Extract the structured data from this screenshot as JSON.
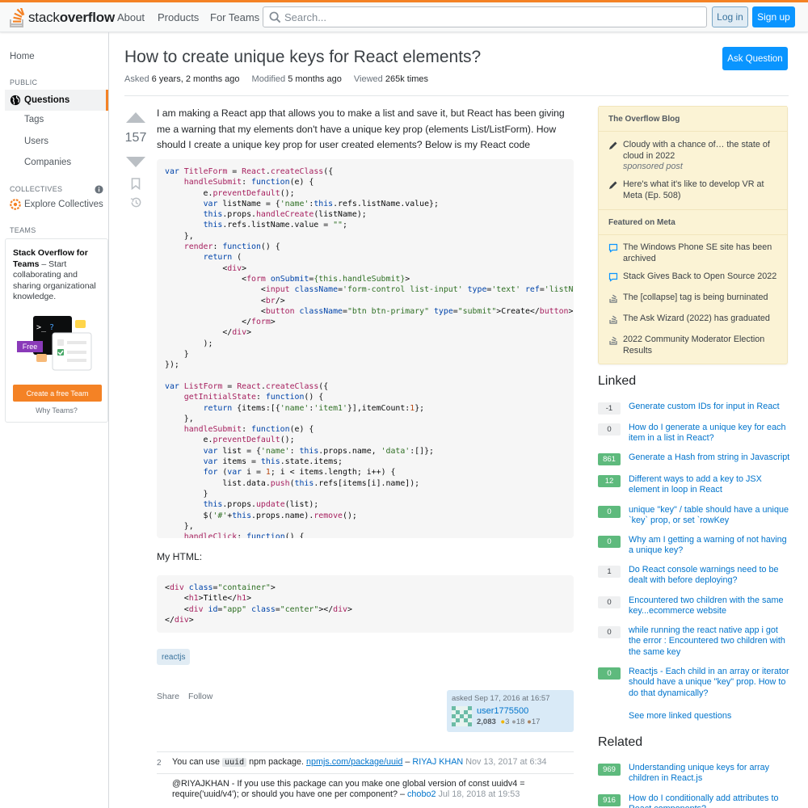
{
  "header": {
    "logo_text_light": "stack",
    "logo_text_bold": "overflow",
    "nav": [
      "About",
      "Products",
      "For Teams"
    ],
    "search_placeholder": "Search...",
    "login_label": "Log in",
    "signup_label": "Sign up"
  },
  "sidebar": {
    "home": "Home",
    "public_label": "PUBLIC",
    "questions": "Questions",
    "tags": "Tags",
    "users": "Users",
    "companies": "Companies",
    "collectives_label": "COLLECTIVES",
    "explore_collectives": "Explore Collectives",
    "teams_label": "TEAMS",
    "teams_title": "Stack Overflow for Teams",
    "teams_desc": " – Start collaborating and sharing organizational knowledge.",
    "teams_free": "Free",
    "teams_button": "Create a free Team",
    "why_teams": "Why Teams?"
  },
  "question": {
    "title": "How to create unique keys for React elements?",
    "asked_label": "Asked",
    "asked_value": "6 years, 2 months ago",
    "modified_label": "Modified",
    "modified_value": "5 months ago",
    "viewed_label": "Viewed",
    "viewed_value": "265k times",
    "ask_button": "Ask Question",
    "votes": "157",
    "body": "I am making a React app that allows you to make a list and save it, but React has been giving me a warning that my elements don't have a unique key prop (elements List/ListForm). How should I create a unique key prop for user created elements? Below is my React code",
    "my_html_label": "My HTML:",
    "tag": "reactjs",
    "share": "Share",
    "follow": "Follow",
    "asked_card_time": "asked Sep 17, 2016 at 16:57",
    "user_name": "user1775500",
    "user_rep": "2,083",
    "gold": "3",
    "silver": "18",
    "bronze": "17"
  },
  "comments": [
    {
      "score": "2",
      "pre": "You can use ",
      "code": "uuid",
      "mid": " npm package. ",
      "link": "npmjs.com/package/uuid",
      "dash": " – ",
      "user": "RIYAJ KHAN",
      "date": " Nov 13, 2017 at 6:34"
    },
    {
      "score": "",
      "text": "@RIYAJKHAN - If you use this package can you make one global version of const uuidv4 = require('uuid/v4'); or should you have one per component? – ",
      "user": "chobo2",
      "date": " Jul 18, 2018 at 19:53"
    }
  ],
  "blog": {
    "header1": "The Overflow Blog",
    "item1": "Cloudy with a chance of… the state of cloud in 2022",
    "item1_sub": "sponsored post",
    "item2": "Here's what it's like to develop VR at Meta (Ep. 508)",
    "header2": "Featured on Meta",
    "meta": [
      "The Windows Phone SE site has been archived",
      "Stack Gives Back to Open Source 2022",
      "The [collapse] tag is being burninated",
      "The Ask Wizard (2022) has graduated",
      "2022 Community Moderator Election Results"
    ]
  },
  "linked": {
    "title": "Linked",
    "items": [
      {
        "score": "-1",
        "text": "Generate custom IDs for input in React",
        "accepted": false
      },
      {
        "score": "0",
        "text": "How do I generate a unique key for each item in a list in React?",
        "accepted": false
      },
      {
        "score": "861",
        "text": "Generate a Hash from string in Javascript",
        "accepted": true
      },
      {
        "score": "12",
        "text": "Different ways to add a key to JSX element in loop in React",
        "accepted": true
      },
      {
        "score": "0",
        "text": "unique \"key\" / table should have a unique `key` prop, or set `rowKey",
        "accepted": true
      },
      {
        "score": "0",
        "text": "Why am I getting a warning of not having a unique key?",
        "accepted": true
      },
      {
        "score": "1",
        "text": "Do React console warnings need to be dealt with before deploying?",
        "accepted": false
      },
      {
        "score": "0",
        "text": "Encountered two children with the same key...ecommerce website",
        "accepted": false
      },
      {
        "score": "0",
        "text": "while running the react native app i got the error : Encountered two children with the same key",
        "accepted": false
      },
      {
        "score": "0",
        "text": "Reactjs - Each child in an array or iterator should have a unique \"key\" prop. How to do that dynamically?",
        "accepted": true
      }
    ],
    "see_more": "See more linked questions"
  },
  "related": {
    "title": "Related",
    "items": [
      {
        "score": "969",
        "text": "Understanding unique keys for array children in React.js",
        "accepted": true
      },
      {
        "score": "916",
        "text": "How do I conditionally add attributes to React components?",
        "accepted": true
      }
    ]
  },
  "colors": {
    "accent": "#f48225",
    "primary_button": "#0a95ff",
    "link": "#0074cc",
    "accepted": "#5eba7d",
    "blog_bg": "#fbf3d5"
  }
}
